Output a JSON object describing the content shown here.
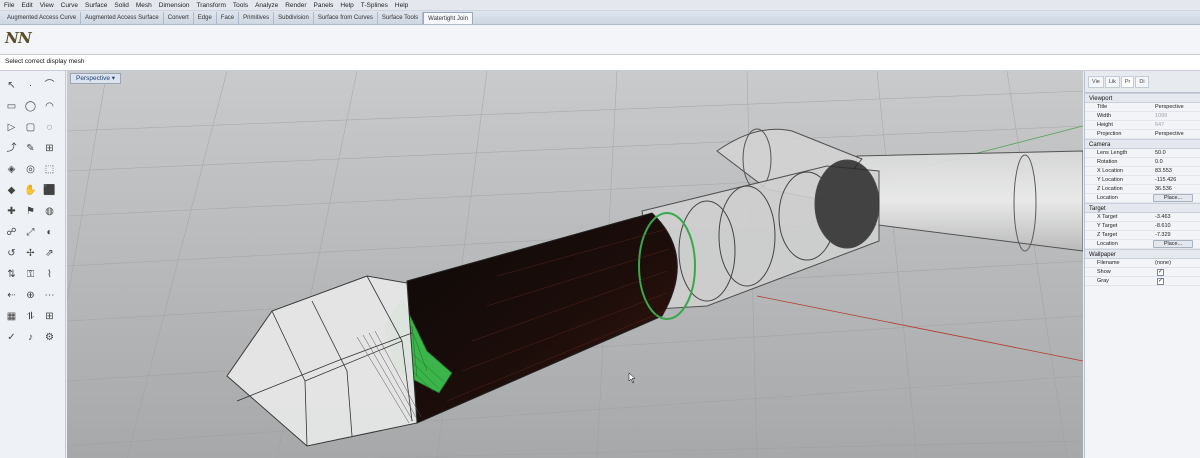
{
  "menu": [
    "File",
    "Edit",
    "View",
    "Curve",
    "Surface",
    "Solid",
    "Mesh",
    "Dimension",
    "Transform",
    "Tools",
    "Analyze",
    "Render",
    "Panels",
    "Help",
    "T-Splines",
    "Help"
  ],
  "tabs": [
    "Augmented Access Curve",
    "Augmented Access Surface",
    "Convert",
    "Edge",
    "Face",
    "Primitives",
    "Subdivision",
    "Surface from Curves",
    "Surface Tools",
    "Watertight Join"
  ],
  "active_tab_index": 9,
  "ribbon": {
    "icon1": "N",
    "icon2": "N"
  },
  "command_prompt": "Select correct display mesh",
  "viewport": {
    "label": "Perspective",
    "dropdown": "▾"
  },
  "left_tools": [
    "↖",
    "·",
    "⌒",
    "▭",
    "◯",
    "◠",
    "▷",
    "▢",
    "◌",
    "⤴",
    "✎",
    "⊞",
    "◈",
    "◎",
    "⬚",
    "◆",
    "✋",
    "⬛",
    "✚",
    "⚑",
    "◍",
    "☍",
    "⤢",
    "◐",
    "↺",
    "✢",
    "⇗",
    "⇅",
    "⚿",
    "⌇",
    "⇠",
    "⊕",
    "⋯",
    "▦",
    "⥮",
    "⊞",
    "✓",
    "♪",
    "⚙"
  ],
  "panel": {
    "tabs": [
      "Vie",
      "Lik",
      "Pr",
      "Di"
    ],
    "active_tab": 2,
    "viewport": {
      "heading": "Viewport",
      "rows": [
        {
          "label": "Title",
          "value": "Perspective",
          "dim": false
        },
        {
          "label": "Width",
          "value": "1099",
          "dim": true
        },
        {
          "label": "Height",
          "value": "647",
          "dim": true
        },
        {
          "label": "Projection",
          "value": "Perspective",
          "dim": false
        }
      ]
    },
    "camera": {
      "heading": "Camera",
      "rows": [
        {
          "label": "Lens Length",
          "value": "50.0"
        },
        {
          "label": "Rotation",
          "value": "0.0"
        },
        {
          "label": "X Location",
          "value": "83.553"
        },
        {
          "label": "Y Location",
          "value": "-115.426"
        },
        {
          "label": "Z Location",
          "value": "36.536"
        }
      ],
      "location_label": "Location",
      "place_button": "Place..."
    },
    "target": {
      "heading": "Target",
      "rows": [
        {
          "label": "X Target",
          "value": "-3.463"
        },
        {
          "label": "Y Target",
          "value": "-8.610"
        },
        {
          "label": "Z Target",
          "value": "-7.329"
        }
      ],
      "location_label": "Location",
      "place_button": "Place..."
    },
    "wallpaper": {
      "heading": "Wallpaper",
      "filename_label": "Filename",
      "filename_value": "(none)",
      "show_label": "Show",
      "gray_label": "Gray",
      "check_mark": "✓"
    }
  }
}
